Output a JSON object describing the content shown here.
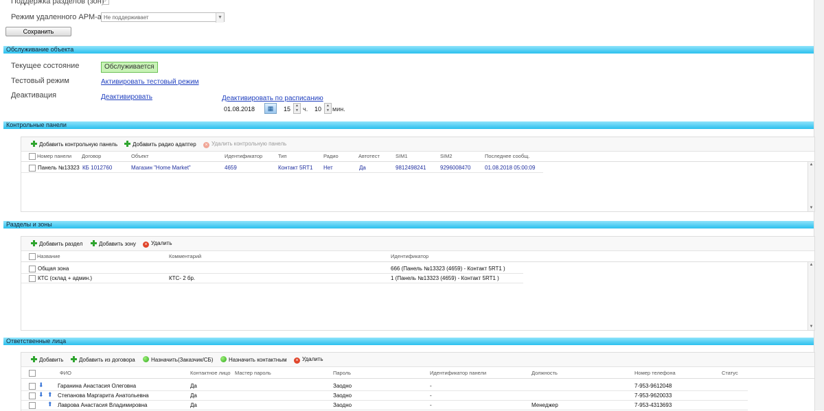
{
  "top": {
    "zones_label": "Поддержка разделов (зон)",
    "remote_label": "Режим удаленного АРМ-а",
    "remote_value": "Не поддерживает",
    "save_label": "Сохранить"
  },
  "service": {
    "title": "Обслуживание объекта",
    "current_state_label": "Текущее состояние",
    "current_state_value": "Обслуживается",
    "test_mode_label": "Тестовый режим",
    "test_mode_link": "Активировать тестовый режим",
    "deactivation_label": "Деактивация",
    "deactivate_link": "Деактивировать",
    "schedule_link": "Деактивировать по расписанию",
    "date": "01.08.2018",
    "hours": "15",
    "hours_unit": "ч.",
    "minutes": "10",
    "minutes_unit": "мин."
  },
  "panels": {
    "title": "Контрольные панели",
    "toolbar": {
      "add_panel": "Добавить контрольную панель",
      "add_radio": "Добавить радио адаптер",
      "delete_panel": "Удалить контрольную панель"
    },
    "columns": [
      "Номер панели",
      "Договор",
      "Объект",
      "Идентификатор",
      "Тип",
      "Радио",
      "Автотест",
      "SIM1",
      "SIM2",
      "Последнее сообщ."
    ],
    "rows": [
      [
        "Панель №13323",
        "КБ 1012760",
        "Магазин \"Home Market\"",
        "4659",
        "Контакт 5RT1",
        "Нет",
        "Да",
        "9812498241",
        "9296008470",
        "01.08.2018 05:00:09"
      ]
    ]
  },
  "zones": {
    "title": "Разделы и зоны",
    "toolbar": {
      "add_section": "Добавить раздел",
      "add_zone": "Добавить зону",
      "delete": "Удалить"
    },
    "columns": [
      "Название",
      "Комментарий",
      "Идентификатор"
    ],
    "rows": [
      [
        "Общая зона",
        "",
        "666 (Панель №13323 (4659) - Контакт 5RT1 )"
      ],
      [
        "КТС (склад + админ.)",
        "КТС- 2 бр.",
        "1 (Панель №13323 (4659) - Контакт 5RT1 )"
      ]
    ]
  },
  "persons": {
    "title": "Ответственные лица",
    "toolbar": {
      "add": "Добавить",
      "add_from_contract": "Добавить из договора",
      "assign_customer": "Назначить(Заказчик/СБ)",
      "assign_contact": "Назначить контактным",
      "delete": "Удалить"
    },
    "columns": [
      "ФИО",
      "Контактное лицо",
      "Мастер пароль",
      "Пароль",
      "Идентификатор панели",
      "Должность",
      "Номер телефона",
      "Статус"
    ],
    "rows": [
      [
        "Гаранина Анастасия Олеговна",
        "Да",
        "",
        "Заодно",
        "-",
        "",
        "7-953-9612048",
        ""
      ],
      [
        "Степанова Маргарита Анатольевна",
        "Да",
        "",
        "Заодно",
        "-",
        "",
        "7-953-9620033",
        ""
      ],
      [
        "Лаврова Анастасия Владимировна",
        "Да",
        "",
        "Заодно",
        "-",
        "Менеджер",
        "7-953-4313693",
        ""
      ]
    ]
  }
}
